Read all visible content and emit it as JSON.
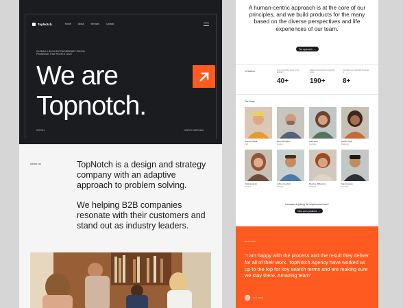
{
  "hero": {
    "brand": "TopNotch.",
    "nav": [
      "Home",
      "About",
      "Services",
      "Contact"
    ],
    "tagline": "GLOBALLY BUILD EXTRAORDINARY DIGITAL PRESENCE THAT PEOPLE LOVE",
    "headline_line1": "We are",
    "headline_line2": "Topnotch.",
    "footer_left": "SCROLL",
    "footer_right": "NORTH CAROLINA"
  },
  "about": {
    "label": "About us",
    "paragraph1": "TopNotch is a design and strategy company with an adaptive approach to problem solving.",
    "paragraph2": "We helping B2B companies resonate with their customers and stand out as industry leaders."
  },
  "approach": {
    "text": "A human-centric approach is at the core of our principles, and we build products for the many based on the diverse perspectives and life experiences of our team.",
    "button": "Our approach"
  },
  "numbers": {
    "title": "In Number",
    "stats": [
      {
        "label": "Our successful years in the industry",
        "value": "40+"
      },
      {
        "label": "Digital and advertising projects done",
        "value": "190+"
      },
      {
        "label": "Countries we operated business in",
        "value": "8+"
      }
    ]
  },
  "team": {
    "title": "Our Team",
    "members": [
      {
        "name": "Brandon Mesa",
        "role": "CEO"
      },
      {
        "name": "Floyd Stephens",
        "role": "Designer"
      },
      {
        "name": "Katie Kent",
        "role": "Developer"
      },
      {
        "name": "Dorian Doyle",
        "role": "Marketing"
      },
      {
        "name": "Virginia Agosti",
        "role": "Designer"
      },
      {
        "name": "Jeffrey Goodwin",
        "role": "Manager"
      },
      {
        "name": "Beatrice Williamson",
        "role": "Strategist"
      },
      {
        "name": "Nigel Hansen",
        "role": "Developer"
      }
    ],
    "cta_text": "Interested in joining the superhuman team?",
    "cta_button": "View open positions"
  },
  "testimonial": {
    "label": "Testimonials",
    "quote": "“I am happy with the process and the result they deliver for all of their work. TopNotch Agency have worked us up to the top for key search terms and are making sure we stay there. Amazing team”",
    "author": "Cole Welsh"
  },
  "colors": {
    "accent": "#ff5a1f",
    "dark": "#1b1c1f"
  }
}
